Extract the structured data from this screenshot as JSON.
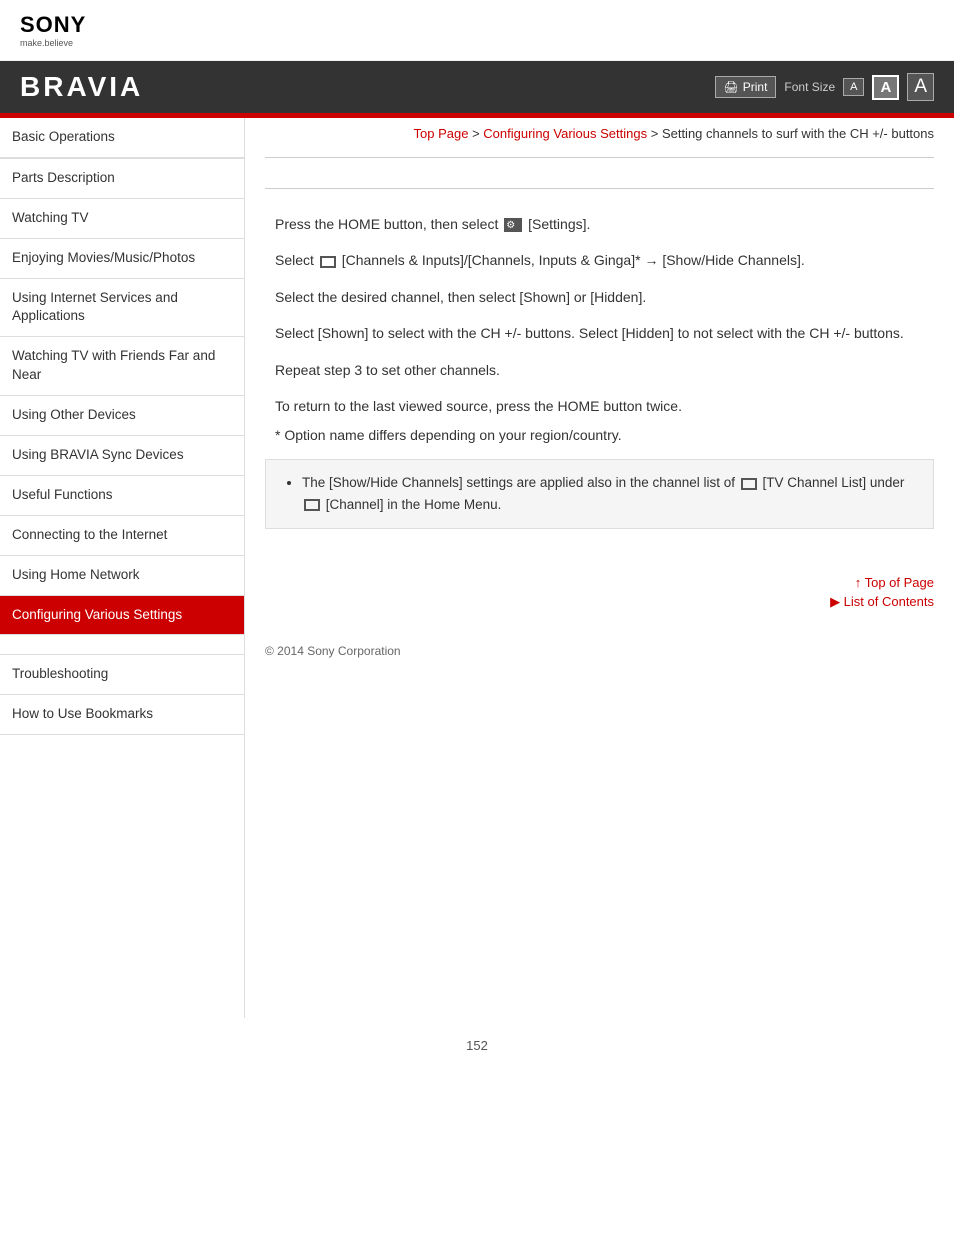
{
  "header": {
    "sony_text": "SONY",
    "tagline": "make.believe",
    "bravia": "BRAVIA",
    "print_label": "Print",
    "font_size_label": "Font Size",
    "font_small": "A",
    "font_medium": "A",
    "font_large": "A"
  },
  "breadcrumb": {
    "top_page": "Top Page",
    "separator1": " > ",
    "configuring": "Configuring Various Settings",
    "separator2": " > ",
    "current": "Setting channels to surf with the CH +/- buttons"
  },
  "sidebar": {
    "items": [
      {
        "label": "Basic Operations",
        "active": false
      },
      {
        "label": "Parts Description",
        "active": false
      },
      {
        "label": "Watching TV",
        "active": false
      },
      {
        "label": "Enjoying Movies/Music/Photos",
        "active": false
      },
      {
        "label": "Using Internet Services and Applications",
        "active": false
      },
      {
        "label": "Watching TV with Friends Far and Near",
        "active": false
      },
      {
        "label": "Using Other Devices",
        "active": false
      },
      {
        "label": "Using BRAVIA Sync Devices",
        "active": false
      },
      {
        "label": "Useful Functions",
        "active": false
      },
      {
        "label": "Connecting to the Internet",
        "active": false
      },
      {
        "label": "Using Home Network",
        "active": false
      },
      {
        "label": "Configuring Various Settings",
        "active": true
      },
      {
        "label": "Troubleshooting",
        "active": false
      },
      {
        "label": "How to Use Bookmarks",
        "active": false
      }
    ]
  },
  "content": {
    "steps": [
      "Press the HOME button, then select ⚙ [Settings].",
      "Select □ [Channels & Inputs]/[Channels, Inputs & Ginga]* → [Show/Hide Channels].",
      "Select the desired channel, then select [Shown] or [Hidden].",
      "Select [Shown] to select with the CH +/- buttons. Select [Hidden] to not select with the CH +/- buttons.",
      "Repeat step 3 to set other channels."
    ],
    "return_note": "To return to the last viewed source, press the HOME button twice.",
    "asterisk_note": "* Option name differs depending on your region/country.",
    "note_box": "The [Show/Hide Channels] settings are applied also in the channel list of 📺 [TV Channel List] under 📺 [Channel] in the Home Menu."
  },
  "footer": {
    "top_of_page": "Top of Page",
    "list_of_contents": "List of Contents",
    "copyright": "© 2014 Sony Corporation",
    "page_number": "152"
  }
}
